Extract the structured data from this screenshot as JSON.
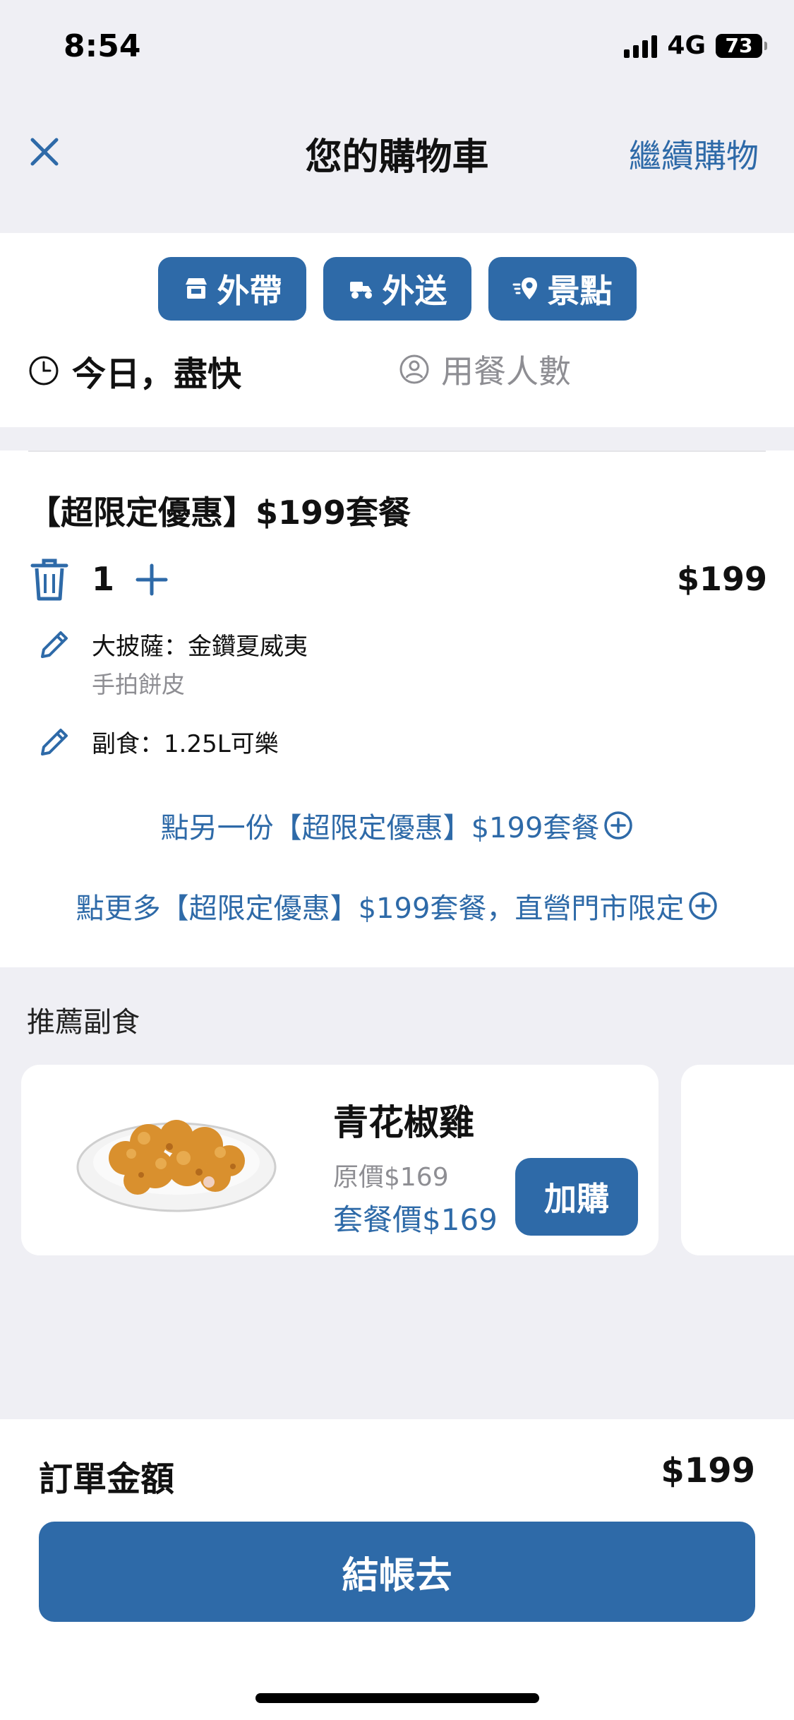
{
  "status_bar": {
    "time": "8:54",
    "network": "4G",
    "battery": "73"
  },
  "header": {
    "title": "您的購物車",
    "continue_label": "繼續購物"
  },
  "modes": [
    {
      "label": "外帶",
      "icon": "store-icon"
    },
    {
      "label": "外送",
      "icon": "scooter-icon"
    },
    {
      "label": "景點",
      "icon": "location-pin-icon"
    }
  ],
  "schedule": {
    "time_label": "今日，盡快",
    "people_placeholder": "用餐人數"
  },
  "cart_item": {
    "title": "【超限定優惠】$199套餐",
    "quantity": "1",
    "price": "$199",
    "options": [
      {
        "main": "大披薩：金鑽夏威夷",
        "sub": "手拍餅皮"
      },
      {
        "main": "副食：1.25L可樂",
        "sub": ""
      }
    ],
    "order_another": "點另一份【超限定優惠】$199套餐",
    "order_more": "點更多【超限定優惠】$199套餐，直營門市限定"
  },
  "recommend": {
    "title": "推薦副食",
    "items": [
      {
        "name": "青花椒雞",
        "original_price": "原價$169",
        "set_price": "套餐價$169",
        "add_label": "加購"
      }
    ]
  },
  "footer": {
    "total_label": "訂單金額",
    "total_value": "$199",
    "checkout_label": "結帳去"
  },
  "colors": {
    "accent": "#2e6aa8",
    "background": "#efeff4",
    "muted": "#8e8e93"
  }
}
